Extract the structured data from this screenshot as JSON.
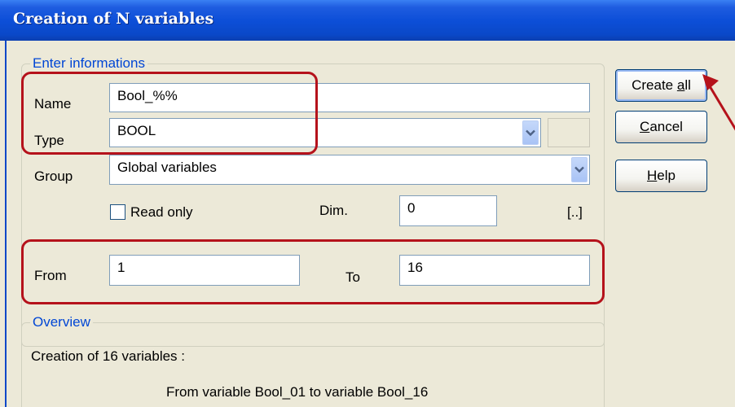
{
  "window": {
    "title": "Creation of N variables"
  },
  "info_group": {
    "legend": "Enter informations",
    "name_label": "Name",
    "name_value": "Bool_%%",
    "type_label": "Type",
    "type_value": "BOOL",
    "group_label": "Group",
    "group_value": "Global variables",
    "readonly_label": "Read only",
    "readonly_checked": false,
    "dim_label": "Dim.",
    "dim_value": "0",
    "dim_button": "[..]",
    "from_label": "From",
    "from_value": "1",
    "to_label": "To",
    "to_value": "16"
  },
  "overview_group": {
    "legend": "Overview",
    "line1": "Creation of 16 variables :",
    "line2": "From variable Bool_01 to variable Bool_16"
  },
  "buttons": {
    "create_all_pre": "Create ",
    "create_all_access": "a",
    "create_all_post": "ll",
    "cancel_access": "C",
    "cancel_post": "ancel",
    "help_access": "H",
    "help_post": "elp"
  },
  "colors": {
    "titlebar": "#0a48c8",
    "legend_text": "#0046d5",
    "annotation": "#b5121b",
    "dialog_bg": "#ece9d8"
  },
  "icons": [
    "chevron-down-icon",
    "annotation-arrow-icon"
  ]
}
